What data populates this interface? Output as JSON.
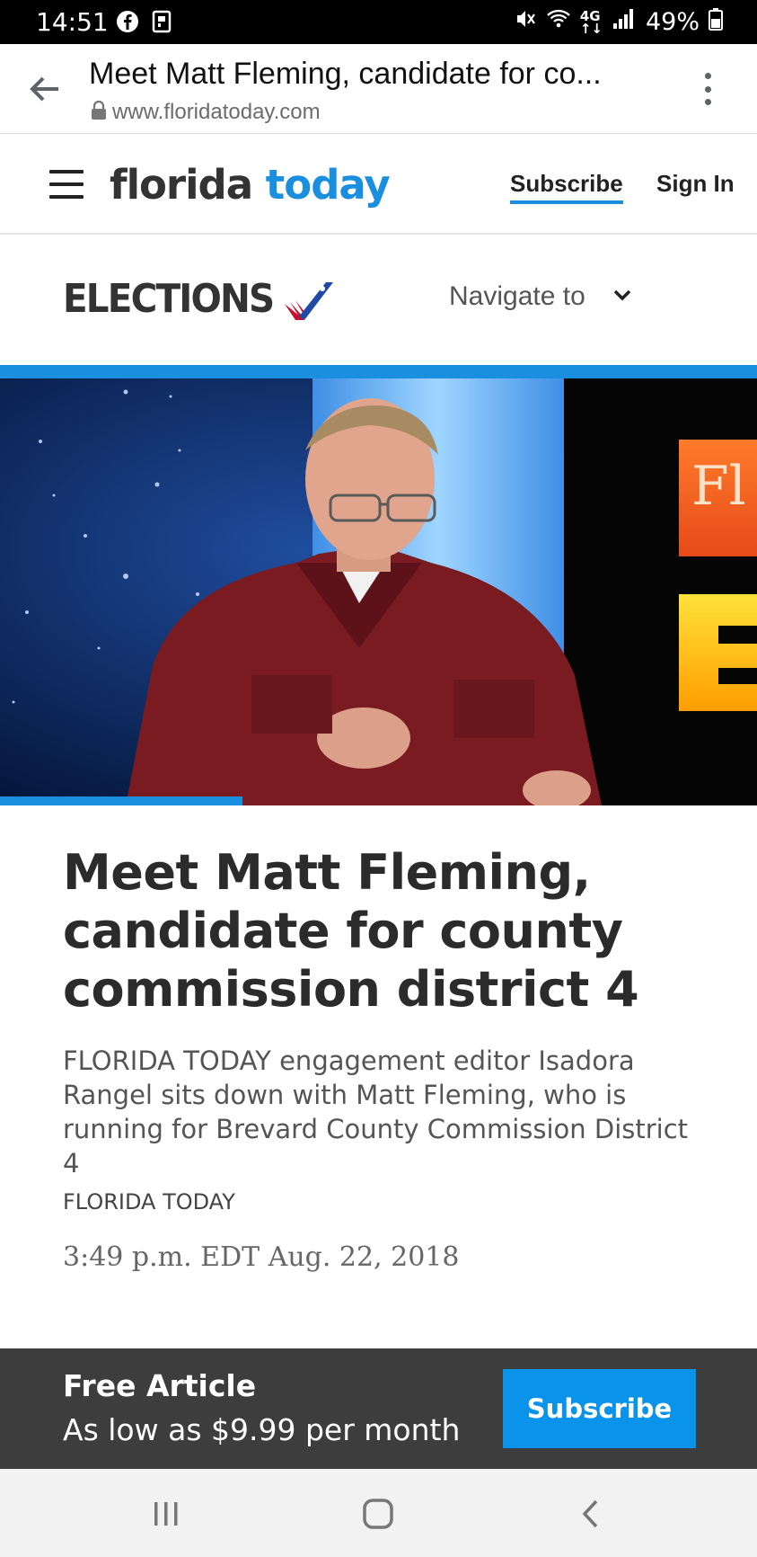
{
  "status_bar": {
    "time": "14:51",
    "battery": "49%",
    "icons": [
      "facebook-icon",
      "cast-icon",
      "mute-icon",
      "wifi-icon",
      "4g-icon",
      "signal-icon",
      "battery-icon"
    ]
  },
  "browser": {
    "page_title": "Meet Matt Fleming, candidate for co...",
    "url": "www.floridatoday.com",
    "icons": [
      "back-arrow-icon",
      "lock-icon",
      "more-vert-icon"
    ]
  },
  "site_header": {
    "logo_part1": "florida",
    "logo_part2": "today",
    "subscribe_label": "Subscribe",
    "signin_label": "Sign In"
  },
  "section": {
    "title": "ELECTIONS",
    "nav_label": "Navigate to"
  },
  "hero": {
    "video_progress": 0.32
  },
  "article": {
    "headline": "Meet Matt Fleming, candidate for county commission district 4",
    "summary": "FLORIDA TODAY engagement editor Isadora Rangel sits down with Matt Fleming, who is running for Brevard County Commission District 4",
    "credit": "FLORIDA TODAY",
    "timestamp": "3:49 p.m. EDT Aug. 22, 2018"
  },
  "paywall": {
    "title": "Free Article",
    "price": "As low as $9.99 per month",
    "button_label": "Subscribe"
  },
  "colors": {
    "brand_blue": "#1a8fe0",
    "banner_bg": "#3d3d3d",
    "button_blue": "#0a93ea"
  }
}
